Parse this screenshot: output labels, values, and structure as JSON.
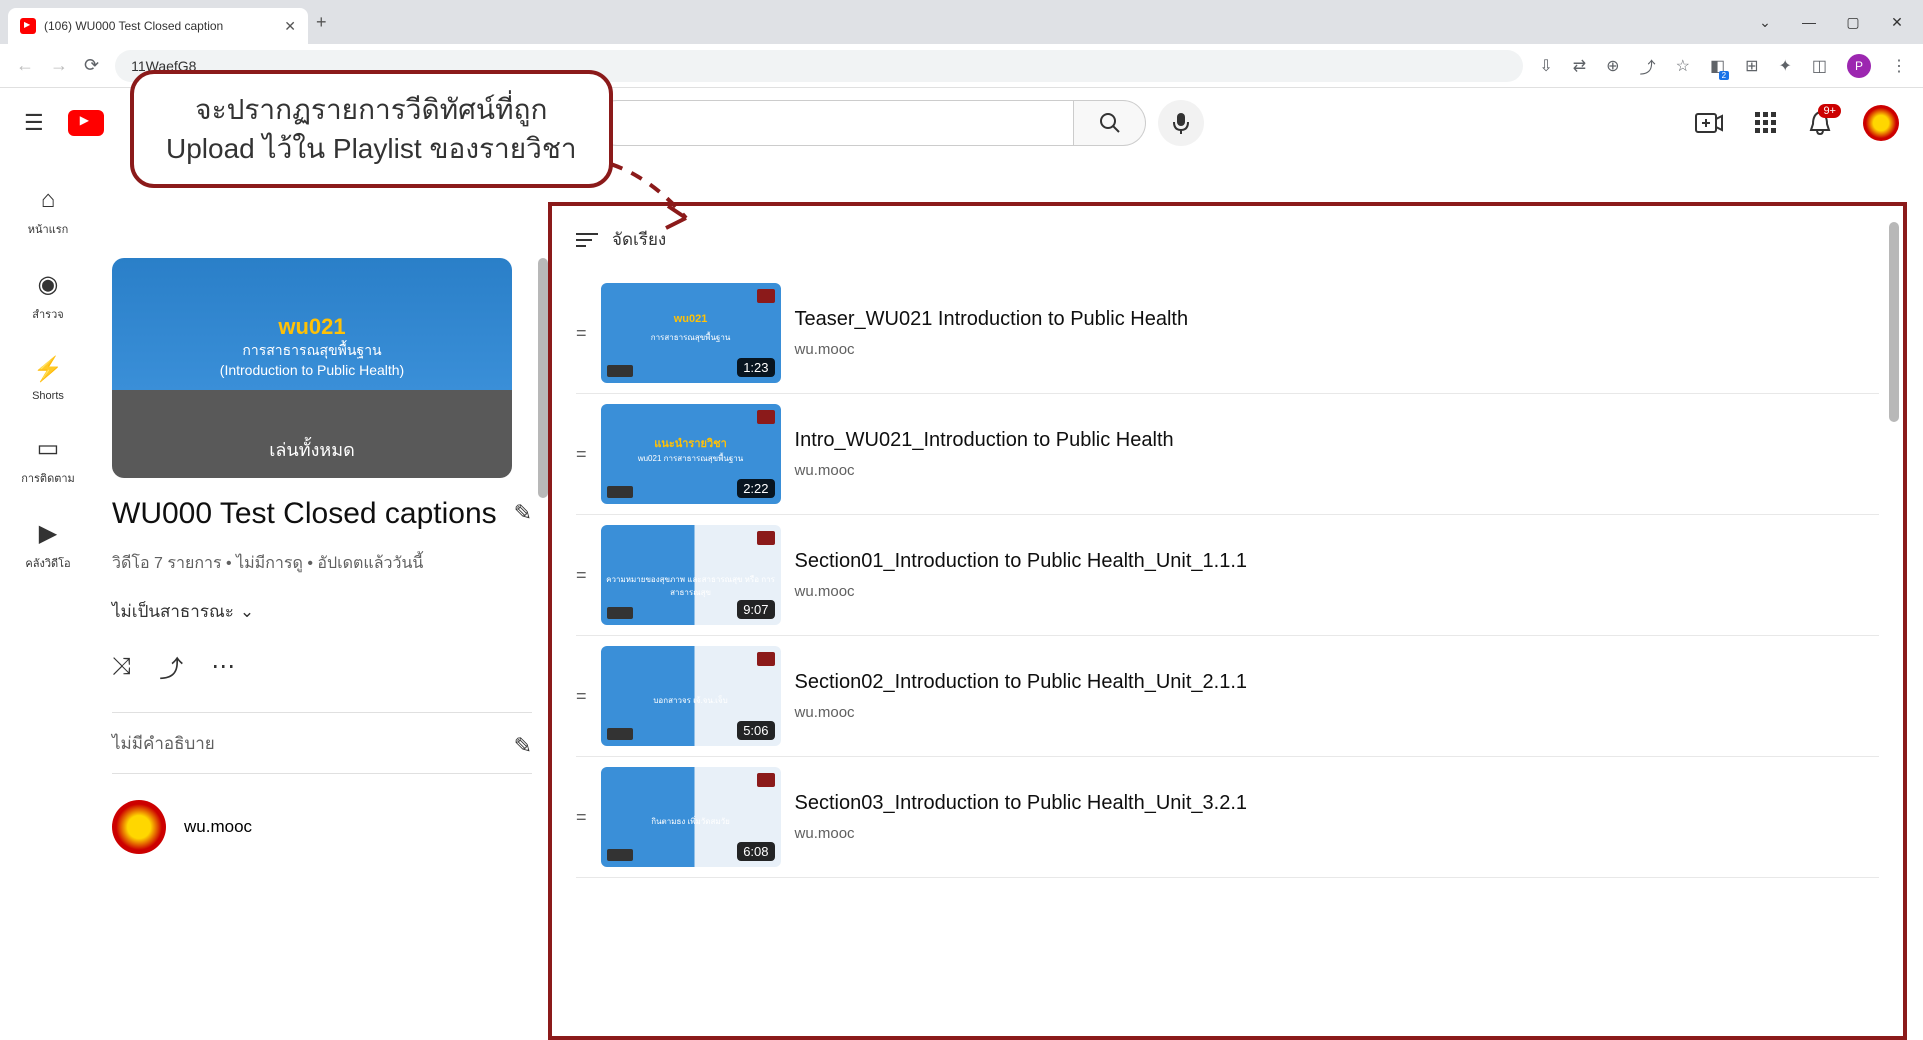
{
  "browser": {
    "tab_title": "(106) WU000 Test Closed caption",
    "url_fragment": "11WaefG8",
    "profile_letter": "P",
    "ext_badge": "2"
  },
  "header": {
    "bell_badge": "9+"
  },
  "callout": {
    "line1": "จะปรากฏรายการวีดิทัศน์ที่ถูก",
    "line2": "Upload ไว้ใน Playlist ของรายวิชา"
  },
  "sidebar": {
    "items": [
      {
        "label": "หน้าแรก",
        "icon": "⌂"
      },
      {
        "label": "สำรวจ",
        "icon": "◉"
      },
      {
        "label": "Shorts",
        "icon": "⚡"
      },
      {
        "label": "การติดตาม",
        "icon": "▭"
      },
      {
        "label": "คลังวิดีโอ",
        "icon": "▶"
      }
    ]
  },
  "playlist": {
    "thumb_code": "wu021",
    "thumb_line1": "การสาธารณสุขพื้นฐาน",
    "thumb_line2": "(Introduction to Public Health)",
    "play_all": "เล่นทั้งหมด",
    "title": "WU000 Test Closed captions",
    "meta": "วิดีโอ 7 รายการ • ไม่มีการดู • อัปเดตแล้ววันนี้",
    "privacy": "ไม่เป็นสาธารณะ",
    "description": "ไม่มีคำอธิบาย",
    "channel": "wu.mooc"
  },
  "sort_label": "จัดเรียง",
  "videos": [
    {
      "title": "Teaser_WU021 Introduction to Public Health",
      "channel": "wu.mooc",
      "duration": "1:23",
      "thumb_label": "wu021",
      "thumb_sub": "การสาธารณสุขพื้นฐาน"
    },
    {
      "title": "Intro_WU021_Introduction to Public Health",
      "channel": "wu.mooc",
      "duration": "2:22",
      "thumb_label": "แนะนำรายวิชา",
      "thumb_sub": "wu021 การสาธารณสุขพื้นฐาน"
    },
    {
      "title": "Section01_Introduction to Public Health_Unit_1.1.1",
      "channel": "wu.mooc",
      "duration": "9:07",
      "thumb_label": "",
      "thumb_sub": "ความหมายของสุขภาพ และสาธารณสุข หรือ การสาธารณสุข",
      "alt": true
    },
    {
      "title": "Section02_Introduction to Public Health_Unit_2.1.1",
      "channel": "wu.mooc",
      "duration": "5:06",
      "thumb_label": "",
      "thumb_sub": "บอกสาวจร เจ้.จน.เจ็บ",
      "alt": true
    },
    {
      "title": "Section03_Introduction to Public Health_Unit_3.2.1",
      "channel": "wu.mooc",
      "duration": "6:08",
      "thumb_label": "",
      "thumb_sub": "กินตามธง เพิ่มวัดสมวัย",
      "alt": true
    }
  ]
}
